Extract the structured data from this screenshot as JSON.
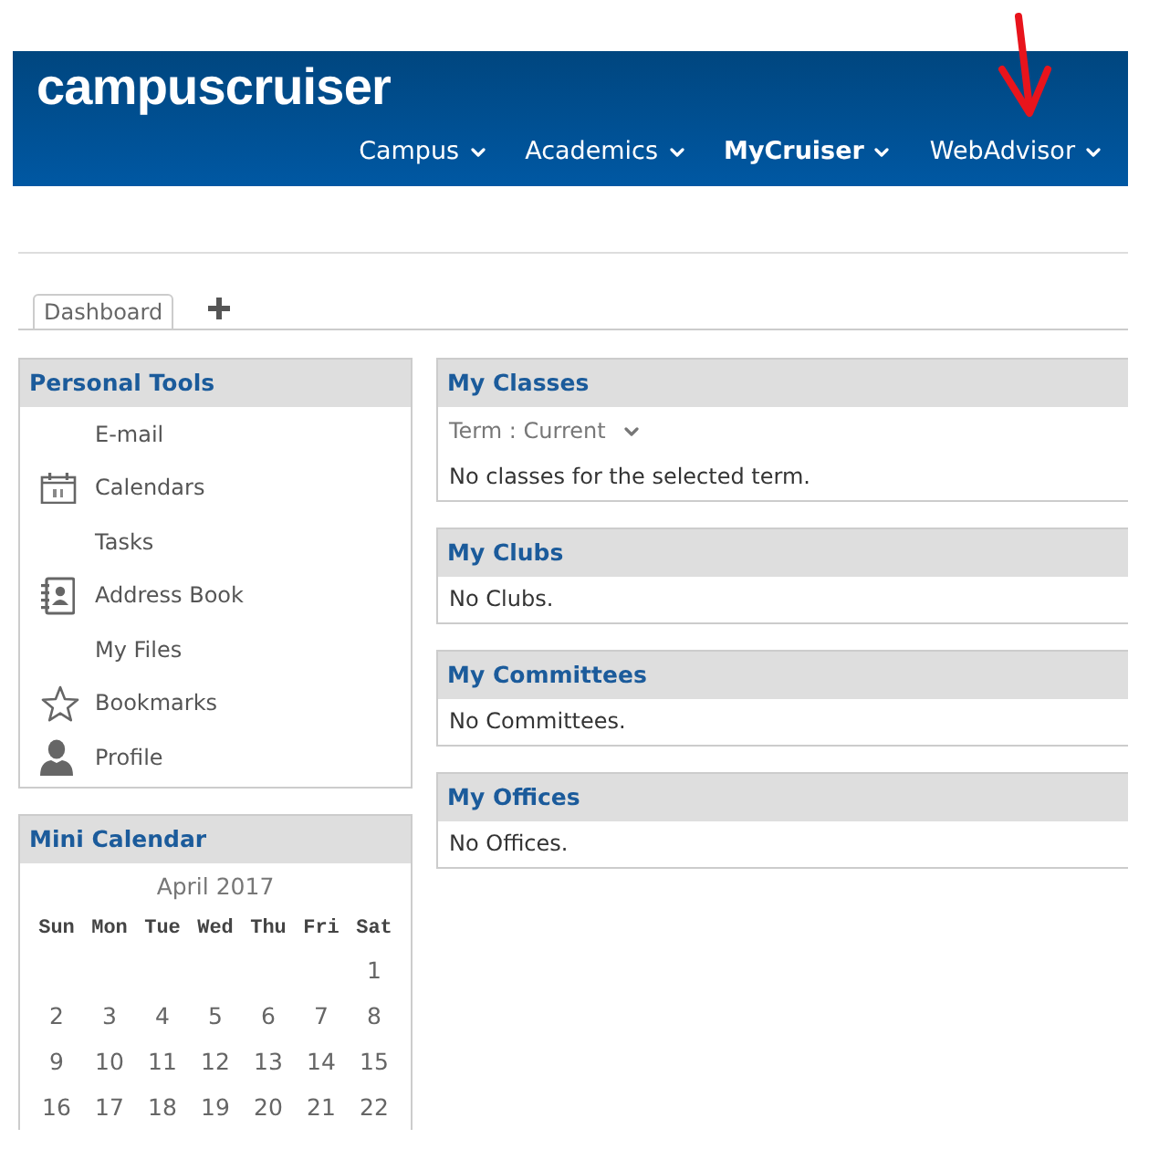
{
  "header": {
    "brand": "campuscruiser",
    "nav": [
      {
        "label": "Campus",
        "selected": false,
        "annotated": false
      },
      {
        "label": "Academics",
        "selected": false,
        "annotated": false
      },
      {
        "label": "MyCruiser",
        "selected": true,
        "annotated": false
      },
      {
        "label": "WebAdvisor",
        "selected": false,
        "annotated": true
      }
    ]
  },
  "tabs": [
    {
      "label": "Dashboard",
      "selected": true
    }
  ],
  "personal_tools": {
    "title": "Personal Tools",
    "items": [
      {
        "label": "E-mail",
        "kind": "email"
      },
      {
        "label": "Calendars",
        "kind": "calendars"
      },
      {
        "label": "Tasks",
        "kind": "tasks"
      },
      {
        "label": "Address Book",
        "kind": "contacts"
      },
      {
        "label": "My Files",
        "kind": "files"
      },
      {
        "label": "Bookmarks",
        "kind": "bookmarks"
      },
      {
        "label": "Profile",
        "kind": "profile"
      }
    ]
  },
  "mini_calendar": {
    "title": "Mini Calendar",
    "month": "April 2017",
    "weekdays": [
      "Sun",
      "Mon",
      "Tue",
      "Wed",
      "Thu",
      "Fri",
      "Sat"
    ],
    "weeks": [
      {
        "kind": "first",
        "days": [
          "1"
        ]
      },
      {
        "kind": "full",
        "days": [
          "2",
          "3",
          "4",
          "5",
          "6",
          "7",
          "8"
        ]
      },
      {
        "kind": "full",
        "days": [
          "9",
          "10",
          "11",
          "12",
          "13",
          "14",
          "15"
        ]
      },
      {
        "kind": "full",
        "days": [
          "16",
          "17",
          "18",
          "19",
          "20",
          "21",
          "22"
        ]
      }
    ]
  },
  "panels": [
    {
      "title": "My Classes",
      "filter": "Term : Current",
      "message": "No classes for the selected term."
    },
    {
      "title": "My Clubs",
      "message": "No Clubs."
    },
    {
      "title": "My Committees",
      "message": "No Committees."
    },
    {
      "title": "My Offices",
      "message": "No Offices."
    }
  ]
}
